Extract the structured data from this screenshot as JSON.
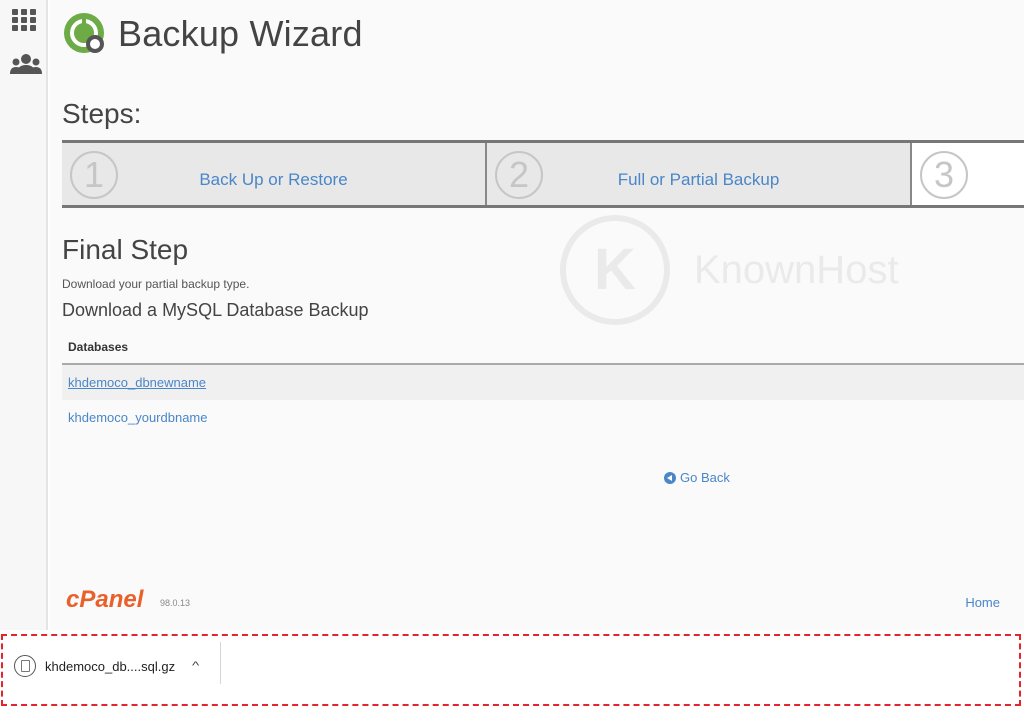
{
  "header": {
    "title": "Backup Wizard"
  },
  "steps": {
    "heading": "Steps:",
    "items": [
      {
        "number": "1",
        "label": "Back Up or Restore"
      },
      {
        "number": "2",
        "label": "Full or Partial Backup"
      },
      {
        "number": "3",
        "label": ""
      }
    ]
  },
  "final": {
    "heading": "Final Step",
    "description": "Download your partial backup type.",
    "subheading": "Download a MySQL Database Backup",
    "table_header": "Databases",
    "databases": [
      "khdemoco_dbnewname",
      "khdemoco_yourdbname"
    ]
  },
  "go_back_label": "Go Back",
  "watermark": {
    "letter": "K",
    "text": "KnownHost"
  },
  "footer": {
    "logo": "cPanel",
    "version": "98.0.13",
    "home_label": "Home"
  },
  "download_bar": {
    "file_name": "khdemoco_db....sql.gz",
    "chevron": "^"
  },
  "colors": {
    "link": "#4a86c8",
    "cpanel": "#e8602a",
    "highlight_border": "#e3262d"
  }
}
